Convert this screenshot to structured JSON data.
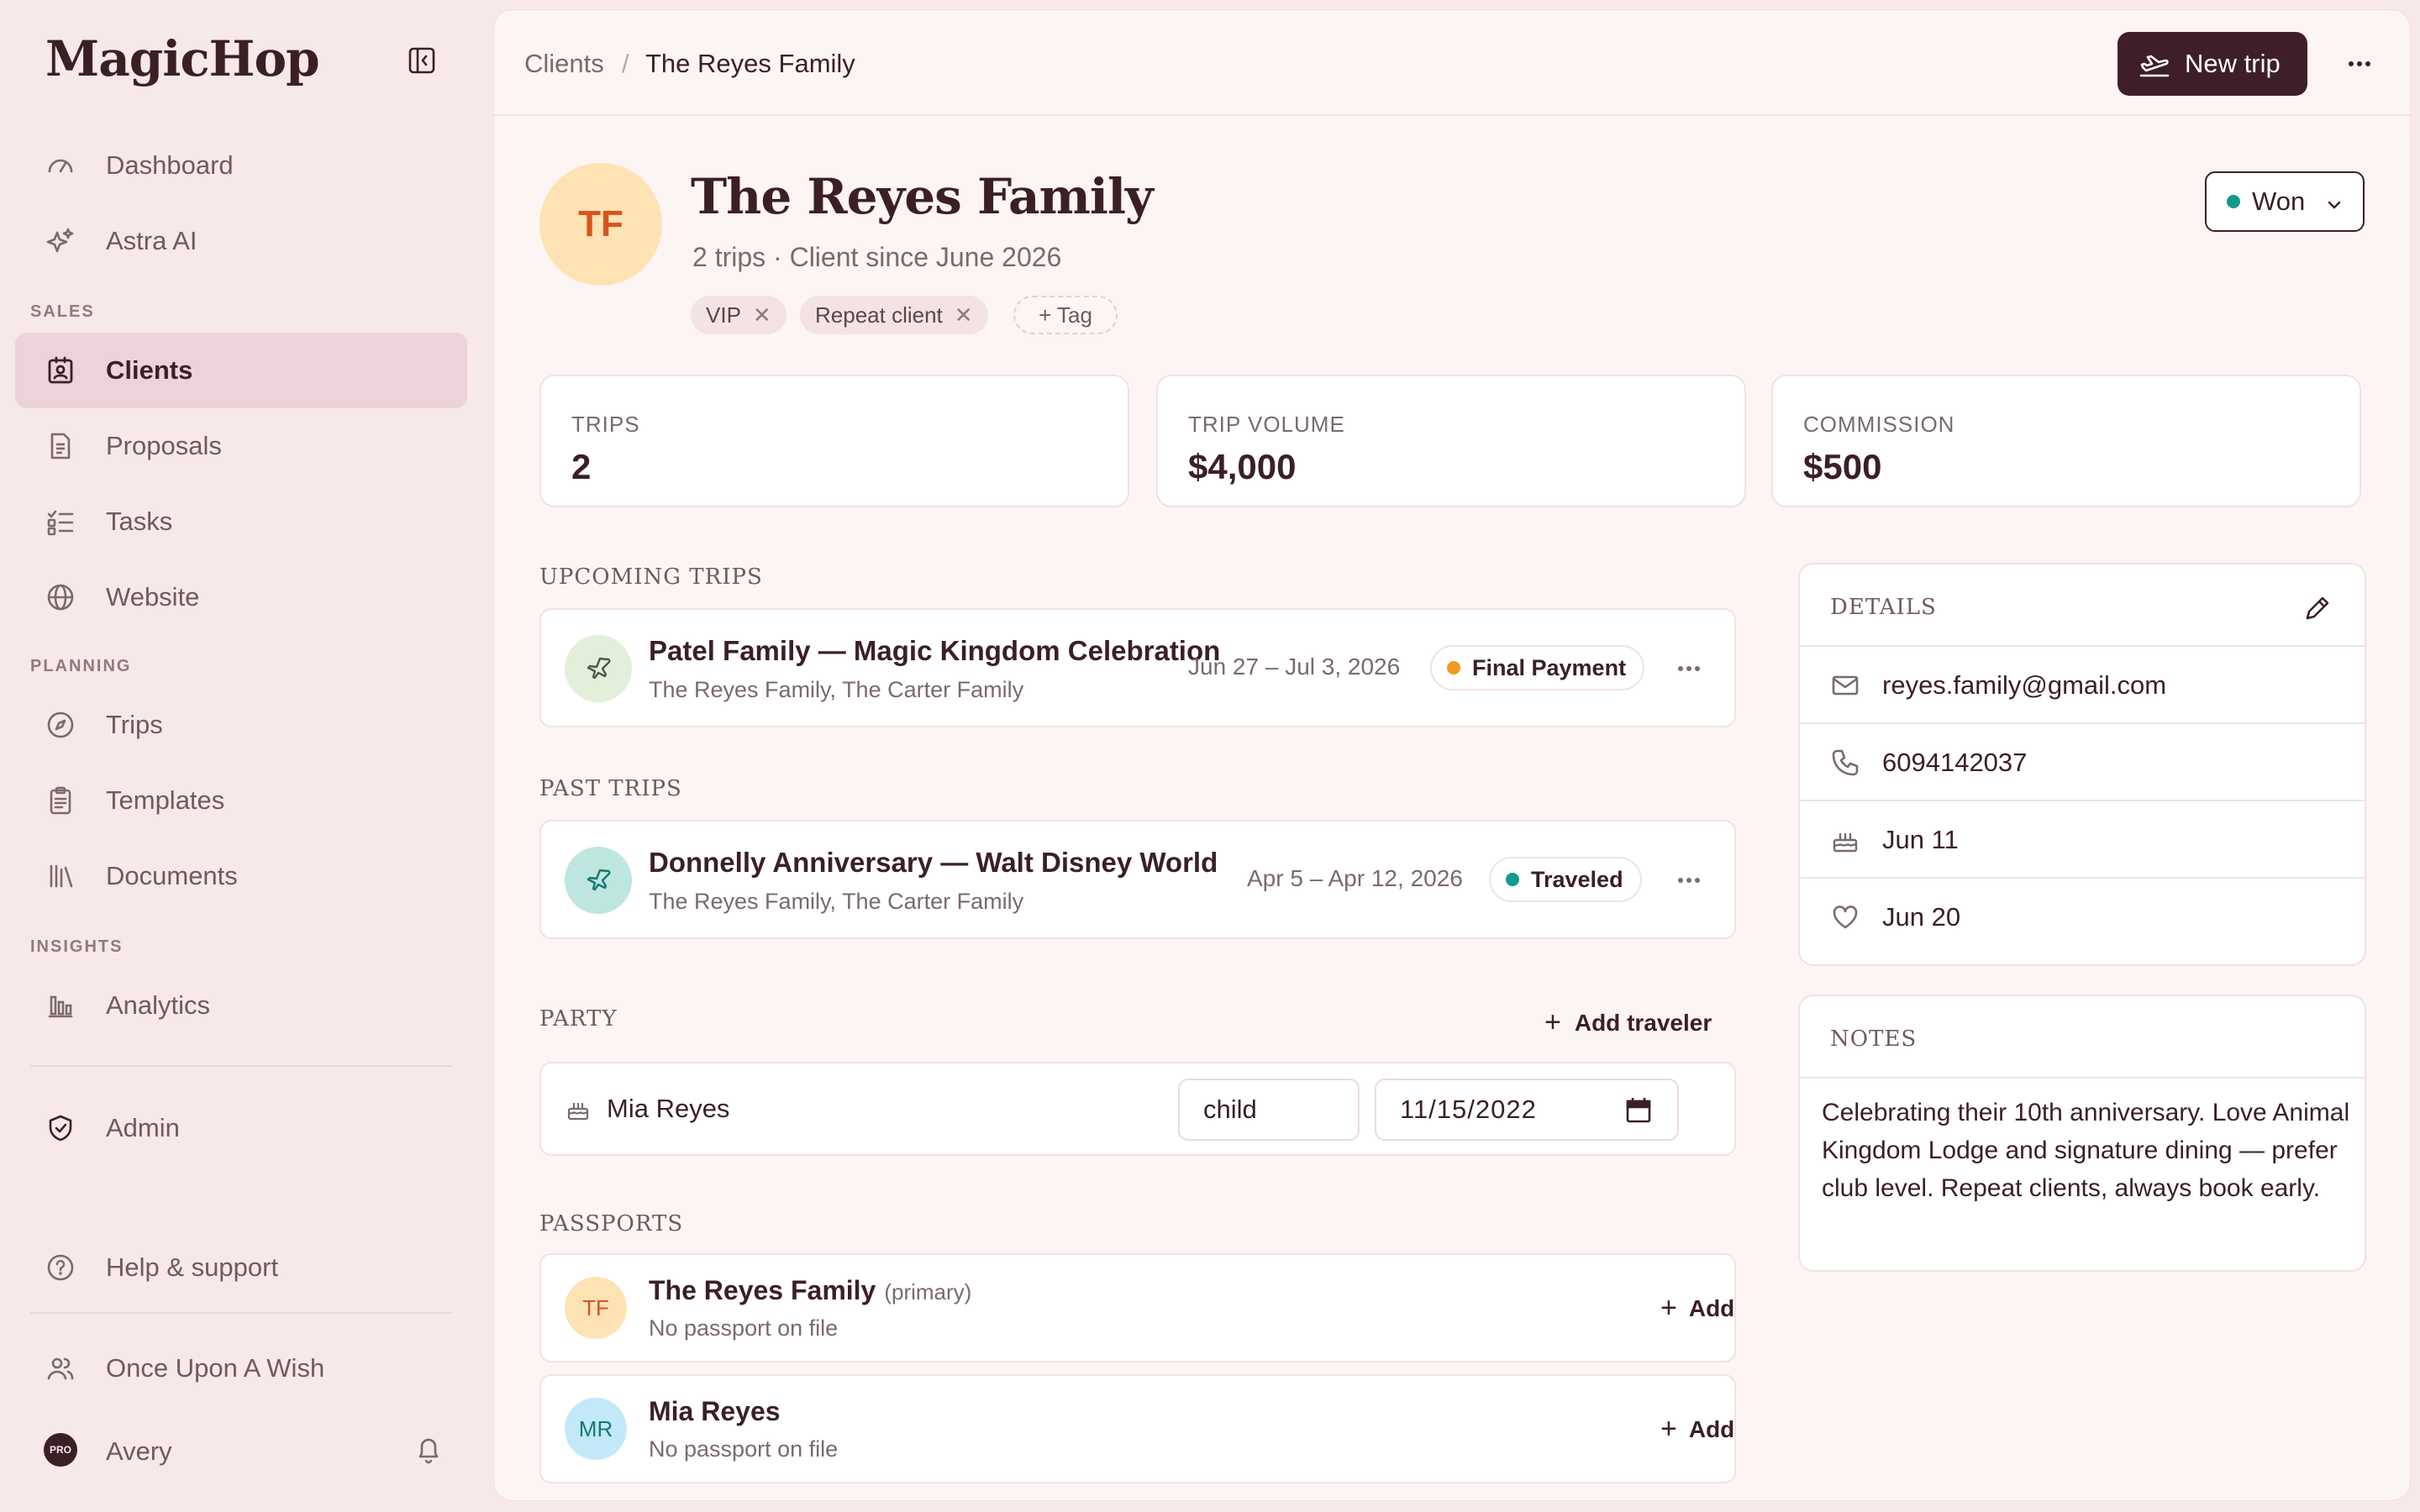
{
  "app": {
    "name": "MagicHop"
  },
  "sidebar": {
    "items_top": [
      {
        "label": "Dashboard",
        "icon": "gauge-icon"
      },
      {
        "label": "Astra AI",
        "icon": "sparkles-icon"
      }
    ],
    "sections": [
      {
        "title": "SALES",
        "items": [
          {
            "label": "Clients",
            "icon": "contact-card-icon",
            "active": true
          },
          {
            "label": "Proposals",
            "icon": "document-icon"
          },
          {
            "label": "Tasks",
            "icon": "checklist-icon"
          },
          {
            "label": "Website",
            "icon": "globe-icon"
          }
        ]
      },
      {
        "title": "PLANNING",
        "items": [
          {
            "label": "Trips",
            "icon": "compass-icon"
          },
          {
            "label": "Templates",
            "icon": "clipboard-icon"
          },
          {
            "label": "Documents",
            "icon": "library-icon"
          }
        ]
      },
      {
        "title": "INSIGHTS",
        "items": [
          {
            "label": "Analytics",
            "icon": "bar-chart-icon"
          }
        ]
      }
    ],
    "admin": "Admin",
    "help": "Help & support",
    "org": "Once Upon A Wish",
    "user": {
      "name": "Avery",
      "badge": "PRO"
    }
  },
  "breadcrumb": {
    "parent": "Clients",
    "separator": "/",
    "current": "The Reyes Family"
  },
  "toolbar": {
    "new_trip": "New trip"
  },
  "client": {
    "initials": "TF",
    "name": "The Reyes Family",
    "subtitle": "2 trips · Client since June 2026",
    "tags": [
      "VIP",
      "Repeat client"
    ],
    "add_tag": "+ Tag",
    "status": "Won",
    "status_color": "#13998c"
  },
  "stats": [
    {
      "label": "TRIPS",
      "value": "2"
    },
    {
      "label": "TRIP VOLUME",
      "value": "$4,000"
    },
    {
      "label": "COMMISSION",
      "value": "$500"
    }
  ],
  "upcoming": {
    "heading": "UPCOMING TRIPS",
    "trips": [
      {
        "title": "Patel Family — Magic Kingdom Celebration",
        "travelers": "The Reyes Family, The Carter Family",
        "dates": "Jun 27 – Jul 3, 2026",
        "status": "Final Payment",
        "status_color": "#f39a1e"
      }
    ]
  },
  "past": {
    "heading": "PAST TRIPS",
    "trips": [
      {
        "title": "Donnelly Anniversary — Walt Disney World",
        "travelers": "The Reyes Family, The Carter Family",
        "dates": "Apr 5 – Apr 12, 2026",
        "status": "Traveled",
        "status_color": "#13998c"
      }
    ]
  },
  "party": {
    "heading": "PARTY",
    "add_label": "Add traveler",
    "members": [
      {
        "name": "Mia Reyes",
        "type": "child",
        "dob": "11/15/2022"
      }
    ]
  },
  "passports": {
    "heading": "PASSPORTS",
    "entries": [
      {
        "initials": "TF",
        "name": "The Reyes Family",
        "note": "(primary)",
        "status": "No passport on file",
        "add": "Add"
      },
      {
        "initials": "MR",
        "name": "Mia Reyes",
        "note": "",
        "status": "No passport on file",
        "add": "Add"
      }
    ]
  },
  "details": {
    "heading": "DETAILS",
    "email": "reyes.family@gmail.com",
    "phone": "6094142037",
    "birthday": "Jun 11",
    "anniversary": "Jun 20"
  },
  "notes": {
    "heading": "NOTES",
    "text": "Celebrating their 10th anniversary. Love Animal Kingdom Lodge and signature dining — prefer club level. Repeat clients, always book early."
  }
}
